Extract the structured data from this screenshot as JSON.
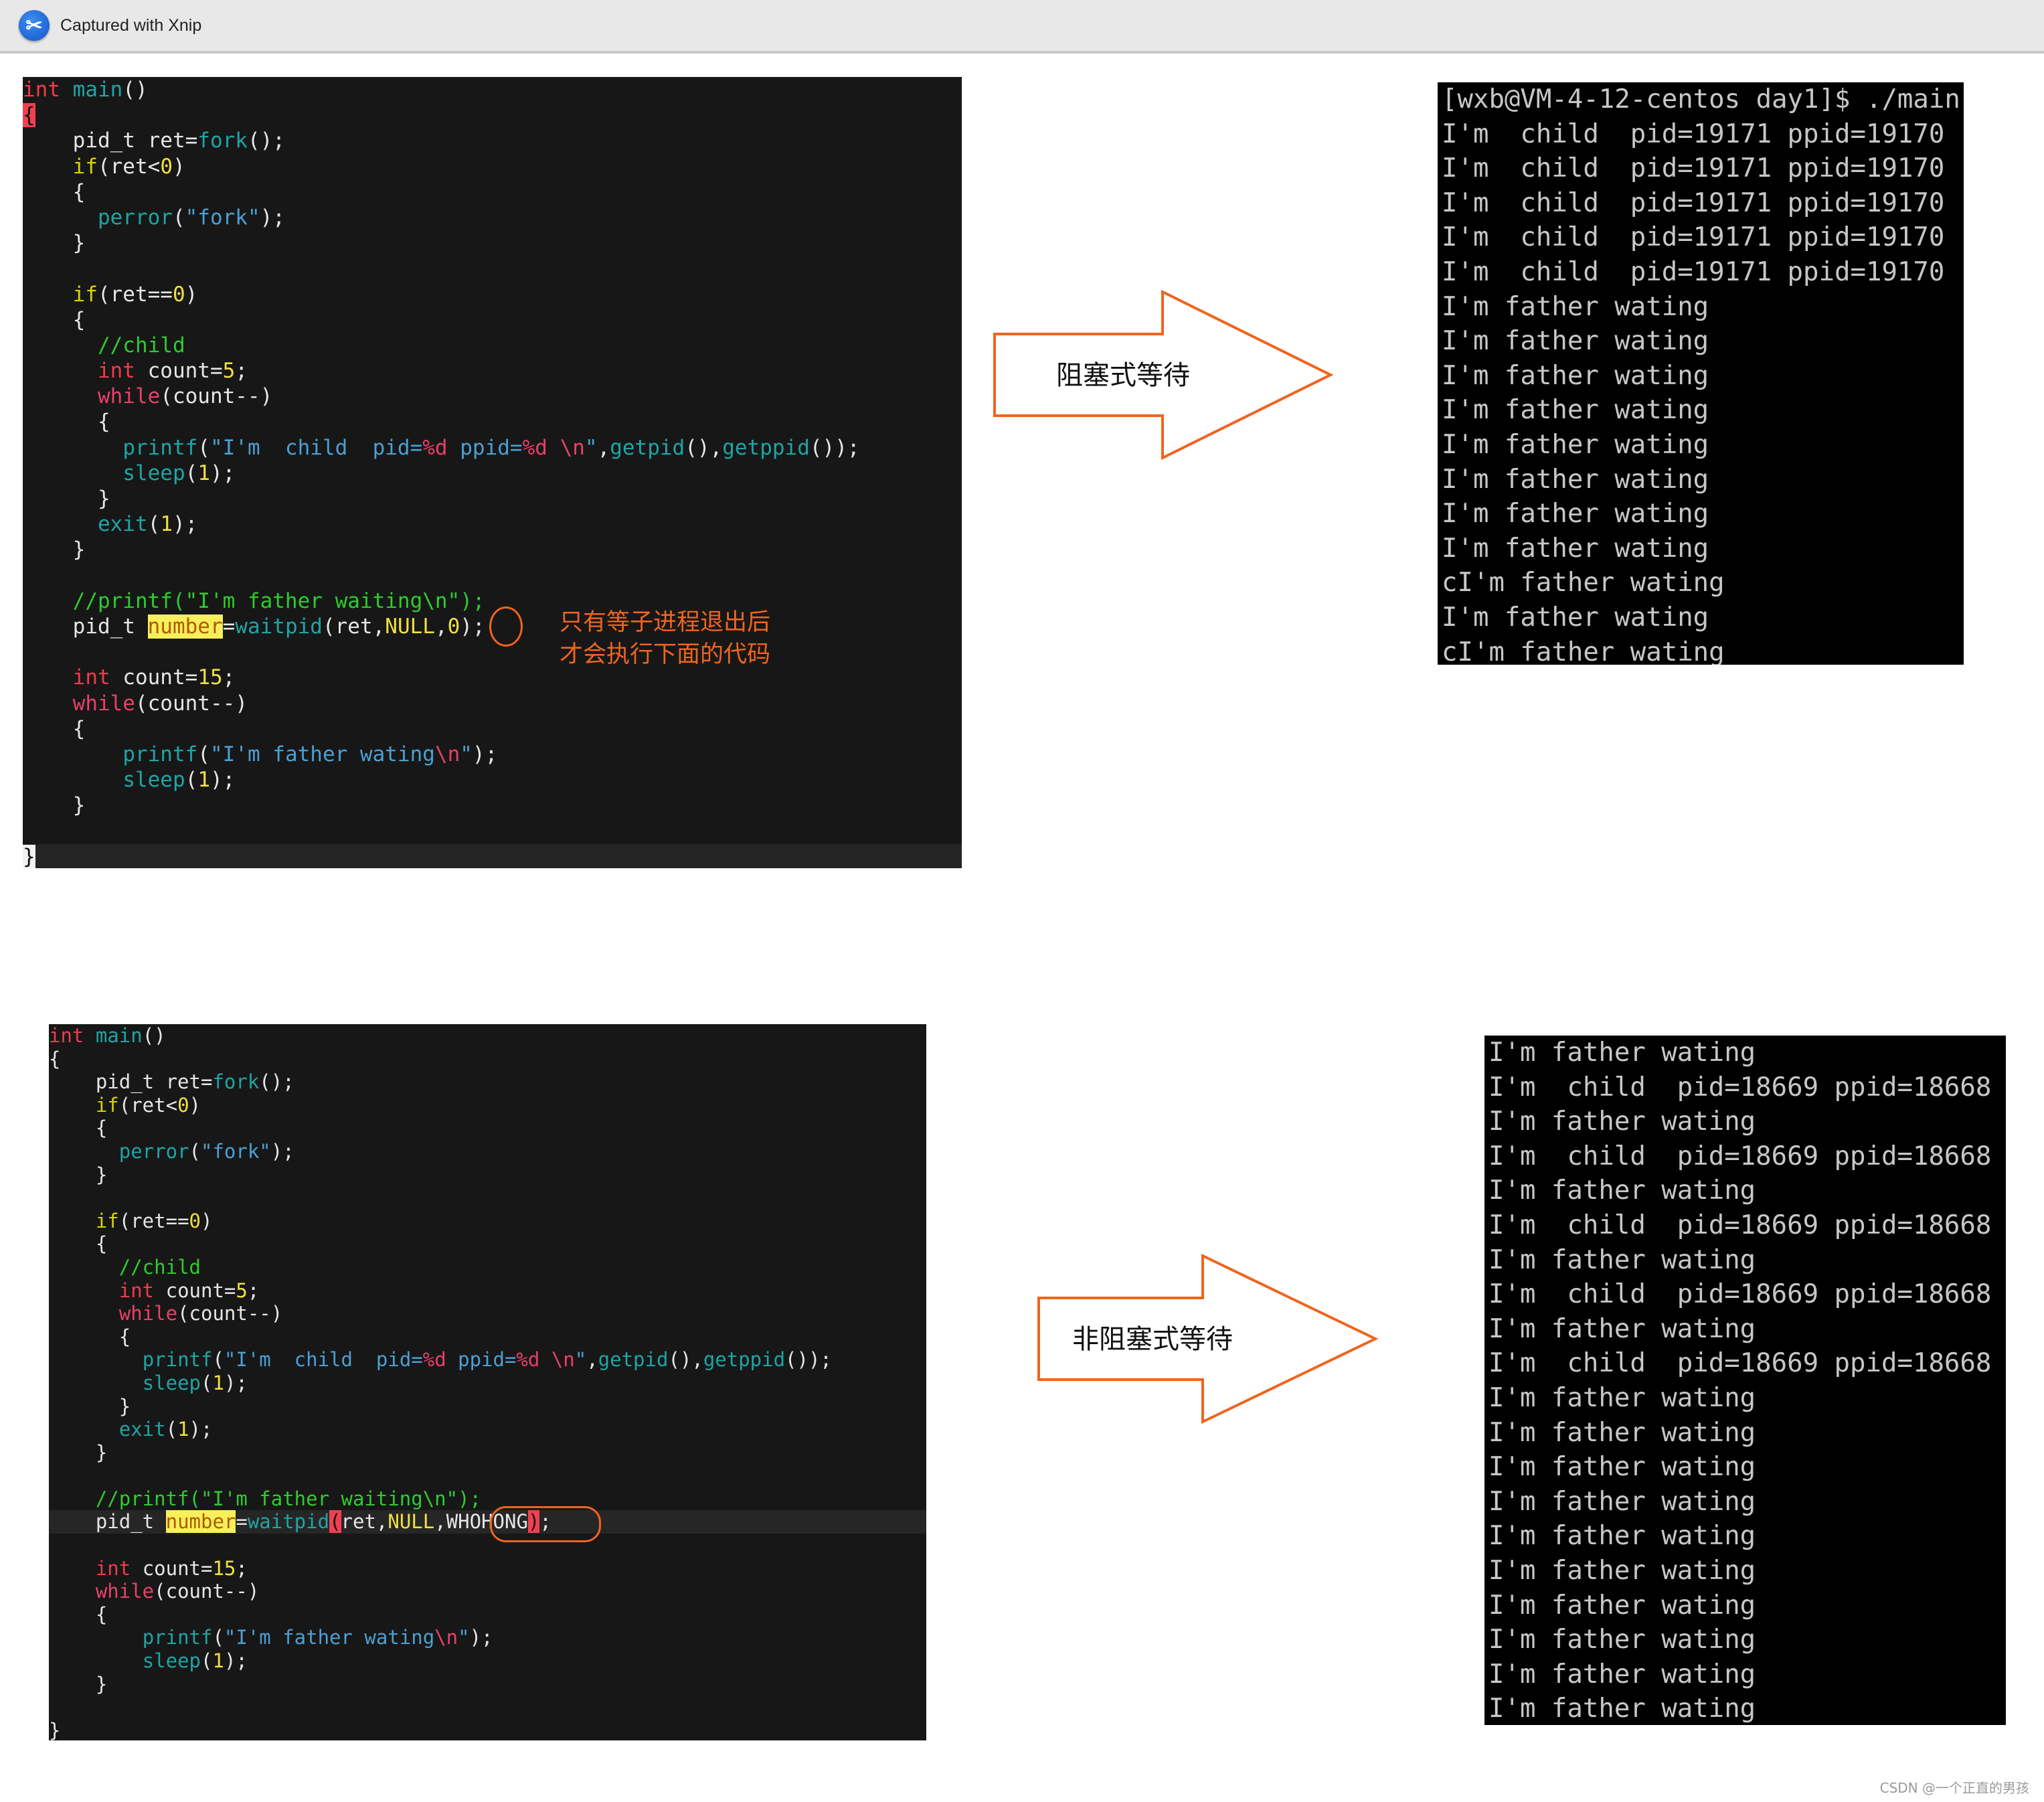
{
  "window": {
    "title": "Captured with Xnip",
    "app_icon": "scissors-icon"
  },
  "blocking": {
    "label": "阻塞式等待",
    "annotation_lines": [
      "只有等子进程退出后",
      "才会执行下面的代码"
    ],
    "code": {
      "l1_int": "int",
      "l1_main": "main",
      "l1_rest": "()",
      "l2_brace": "{",
      "l3_a": "    pid_t ret=",
      "l3_fork": "fork",
      "l3_b": "();",
      "l4_if": "if",
      "l4_a": "(ret<",
      "l4_num": "0",
      "l4_b": ")",
      "l5": "    {",
      "l6_fn": "perror",
      "l6_a": "(",
      "l6_str": "\"fork\"",
      "l6_b": ");",
      "l7": "    }",
      "l9_if": "if",
      "l9_a": "(ret==",
      "l9_num": "0",
      "l9_b": ")",
      "l10": "    {",
      "l11_cmt": "//child",
      "l12_int": "int",
      "l12_a": " count=",
      "l12_num": "5",
      "l12_b": ";",
      "l13_while": "while",
      "l13_a": "(count--)",
      "l14": "      {",
      "l15_fn": "printf",
      "l15_a": "(",
      "l15_s1": "\"I'm  child  pid=",
      "l15_f1": "%d",
      "l15_s2": " ppid=",
      "l15_f2": "%d",
      "l15_s3": " ",
      "l15_f3": "\\n",
      "l15_s4": "\"",
      "l15_b": ",",
      "l15_g1": "getpid",
      "l15_c": "(),",
      "l15_g2": "getppid",
      "l15_d": "());",
      "l16_fn": "sleep",
      "l16_a": "(",
      "l16_num": "1",
      "l16_b": ");",
      "l17": "      }",
      "l18_fn": "exit",
      "l18_a": "(",
      "l18_num": "1",
      "l18_b": ");",
      "l19": "    }",
      "l21_cmt": "//printf(\"I'm father waiting\\n\");",
      "l22_a": "    pid_t ",
      "l22_var": "number",
      "l22_b": "=",
      "l22_fn": "waitpid",
      "l22_c": "(ret,",
      "l22_null": "NULL",
      "l22_d": ",",
      "l22_opt": "0",
      "l22_e": ");",
      "l24_int": "int",
      "l24_a": " count=",
      "l24_num": "15",
      "l24_b": ";",
      "l25_while": "while",
      "l25_a": "(count--)",
      "l26": "    {",
      "l27_fn": "printf",
      "l27_a": "(",
      "l27_s1": "\"I'm father wating",
      "l27_f": "\\n",
      "l27_s2": "\"",
      "l27_b": ");",
      "l28_fn": "sleep",
      "l28_a": "(",
      "l28_num": "1",
      "l28_b": ");",
      "l29": "    }",
      "l31": "}"
    },
    "terminal_lines": [
      "[wxb@VM-4-12-centos day1]$ ./main",
      "I'm  child  pid=19171 ppid=19170",
      "I'm  child  pid=19171 ppid=19170",
      "I'm  child  pid=19171 ppid=19170",
      "I'm  child  pid=19171 ppid=19170",
      "I'm  child  pid=19171 ppid=19170",
      "I'm father wating",
      "I'm father wating",
      "I'm father wating",
      "I'm father wating",
      "I'm father wating",
      "I'm father wating",
      "I'm father wating",
      "I'm father wating",
      "cI'm father wating",
      "I'm father wating",
      "cI'm father wating"
    ]
  },
  "nonblocking": {
    "label": "非阻塞式等待",
    "code": {
      "l22_opt": "WHOHONG"
    },
    "terminal_lines": [
      "I'm father wating",
      "I'm  child  pid=18669 ppid=18668",
      "I'm father wating",
      "I'm  child  pid=18669 ppid=18668",
      "I'm father wating",
      "I'm  child  pid=18669 ppid=18668",
      "I'm father wating",
      "I'm  child  pid=18669 ppid=18668",
      "I'm father wating",
      "I'm  child  pid=18669 ppid=18668",
      "I'm father wating",
      "I'm father wating",
      "I'm father wating",
      "I'm father wating",
      "I'm father wating",
      "I'm father wating",
      "I'm father wating",
      "I'm father wating",
      "I'm father wating",
      "I'm father wating"
    ]
  },
  "colors": {
    "accent_orange": "#f0641e",
    "code_bg": "#171717",
    "terminal_bg": "#000000"
  },
  "watermark": "CSDN @一个正直的男孩"
}
